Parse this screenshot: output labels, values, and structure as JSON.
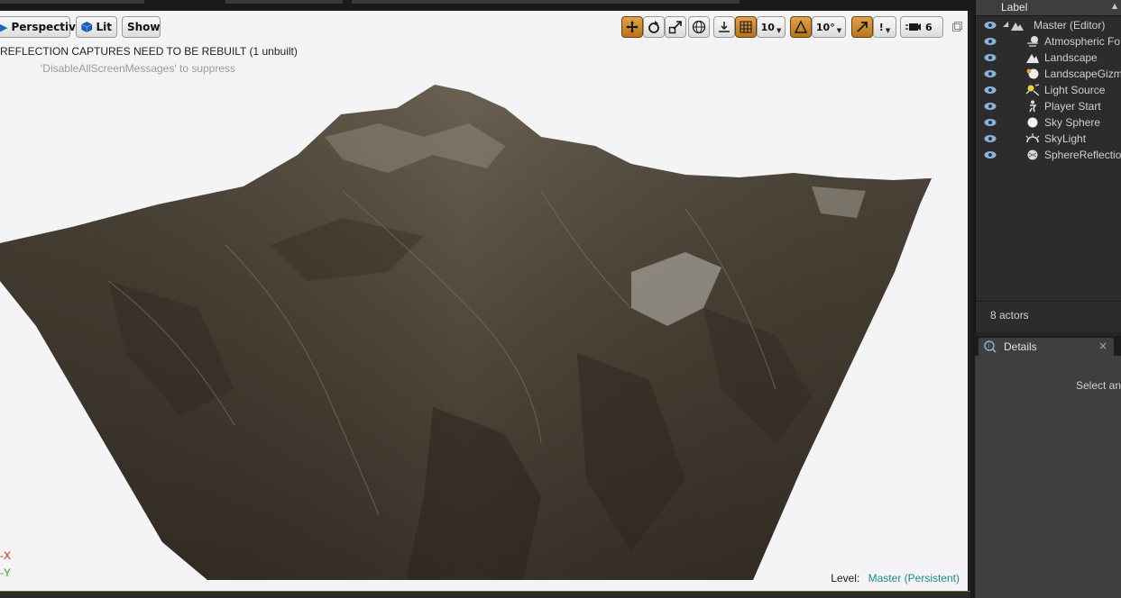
{
  "viewport": {
    "perspective_label": "Perspective",
    "lit_label": "Lit",
    "show_label": "Show",
    "grid_snap_value": "10",
    "rotation_snap_value": "10°",
    "scale_snap_value": "!",
    "camera_speed_value": "6",
    "message_reflection": "REFLECTION CAPTURES NEED TO BE REBUILT (1 unbuilt)",
    "message_suppress": "'DisableAllScreenMessages' to suppress",
    "axis_x": "-X",
    "axis_y": "-Y",
    "level_prefix": "Level:",
    "level_name": "Master (Persistent)",
    "colors": {
      "active_tool": "#c8841f",
      "axis_x": "#d02020",
      "axis_y": "#2aa02a",
      "level_name": "#1e8a8a"
    }
  },
  "outliner": {
    "header_label": "Label",
    "items": [
      {
        "name": "Master (Editor)",
        "icon": "world-icon"
      },
      {
        "name": "Atmospheric Fo",
        "icon": "fog-icon"
      },
      {
        "name": "Landscape",
        "icon": "landscape-icon"
      },
      {
        "name": "LandscapeGizm",
        "icon": "gizmo-icon"
      },
      {
        "name": "Light Source",
        "icon": "sun-icon"
      },
      {
        "name": "Player Start",
        "icon": "player-start-icon"
      },
      {
        "name": "Sky Sphere",
        "icon": "sphere-icon"
      },
      {
        "name": "SkyLight",
        "icon": "skylight-icon"
      },
      {
        "name": "SphereReflection",
        "icon": "reflection-capture-icon"
      }
    ],
    "actor_count": "8 actors"
  },
  "details": {
    "tab_label": "Details",
    "empty_text": "Select an"
  }
}
